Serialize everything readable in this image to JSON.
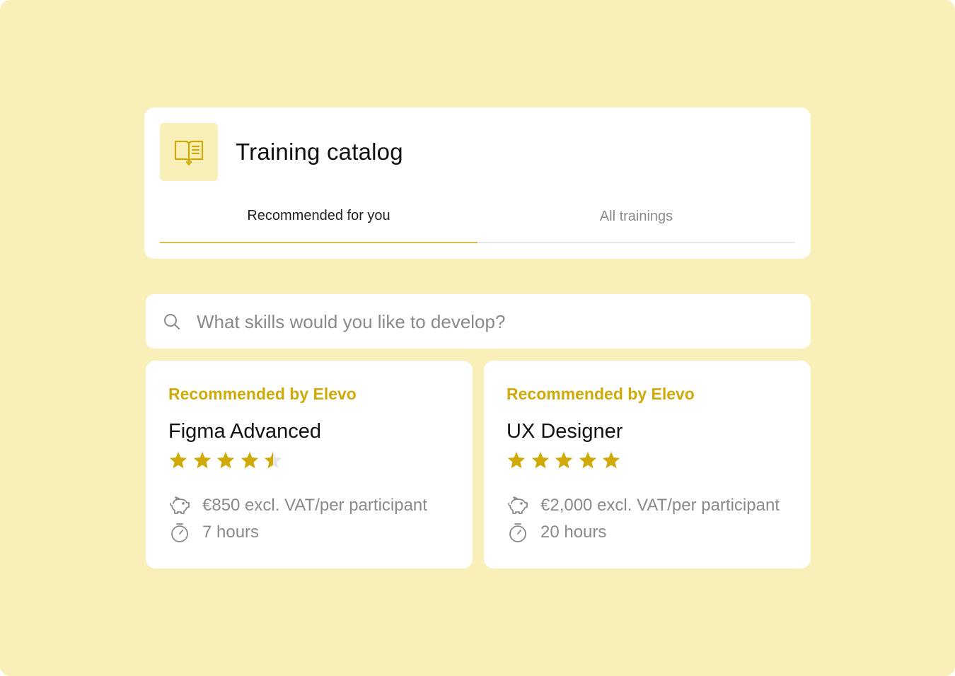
{
  "header": {
    "title": "Training catalog",
    "icon": "open-book-icon",
    "tabs": [
      {
        "label": "Recommended for you",
        "active": true
      },
      {
        "label": "All trainings",
        "active": false
      }
    ]
  },
  "search": {
    "placeholder": "What skills would you like to develop?",
    "value": "",
    "icon": "search-icon"
  },
  "courses": [
    {
      "badge": "Recommended by Elevo",
      "title": "Figma Advanced",
      "rating": 4.5,
      "rating_max": 5,
      "price": "€850 excl. VAT/per participant",
      "price_icon": "piggy-bank-icon",
      "duration": "7 hours",
      "duration_icon": "stopwatch-icon"
    },
    {
      "badge": "Recommended by Elevo",
      "title": "UX Designer",
      "rating": 5,
      "rating_max": 5,
      "price": "€2,000 excl. VAT/per participant",
      "price_icon": "piggy-bank-icon",
      "duration": "20 hours",
      "duration_icon": "stopwatch-icon"
    }
  ],
  "colors": {
    "background": "#f8f0b8",
    "accent": "#cfaa08",
    "tab_underline": "#d7bd3c",
    "muted_text": "#8a8a8a",
    "star_empty": "#e6e6e6"
  }
}
